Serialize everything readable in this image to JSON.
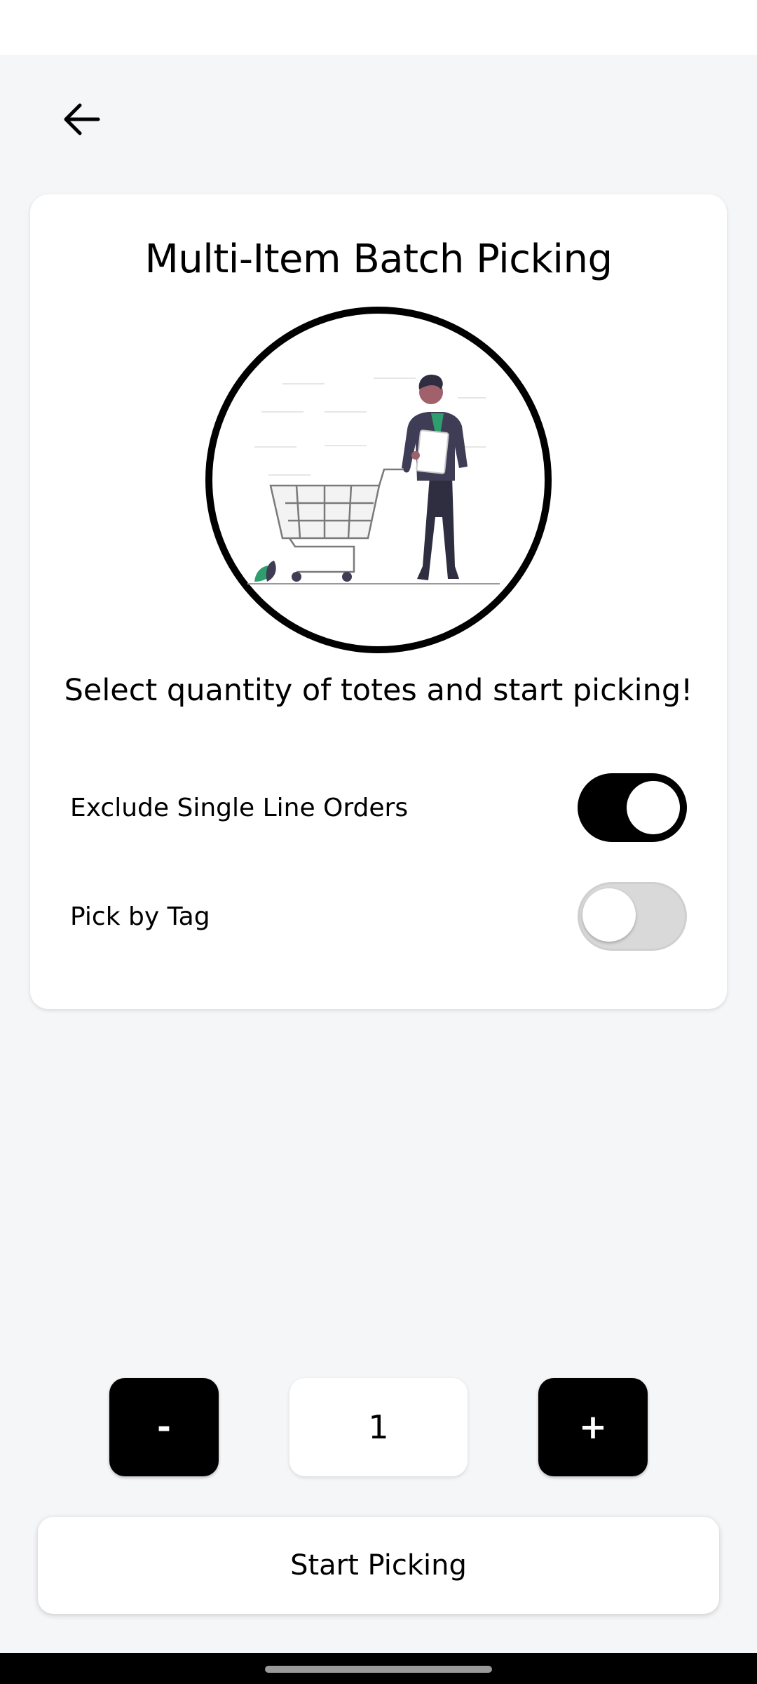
{
  "header": {
    "back_icon": "arrow-left-icon"
  },
  "card": {
    "title": "Multi-Item Batch Picking",
    "illustration": "person-with-shopping-cart-illustration",
    "subtitle": "Select quantity of totes and start picking!",
    "options": [
      {
        "label": "Exclude Single Line Orders",
        "enabled": true
      },
      {
        "label": "Pick by Tag",
        "enabled": false
      }
    ]
  },
  "stepper": {
    "decrement_label": "-",
    "quantity": "1",
    "increment_label": "+"
  },
  "actions": {
    "start_label": "Start Picking"
  },
  "colors": {
    "accent": "#000000",
    "background": "#f5f6f8",
    "card": "#ffffff",
    "toggle_off": "#d9d9d9",
    "plant": "#2f9e6e"
  }
}
